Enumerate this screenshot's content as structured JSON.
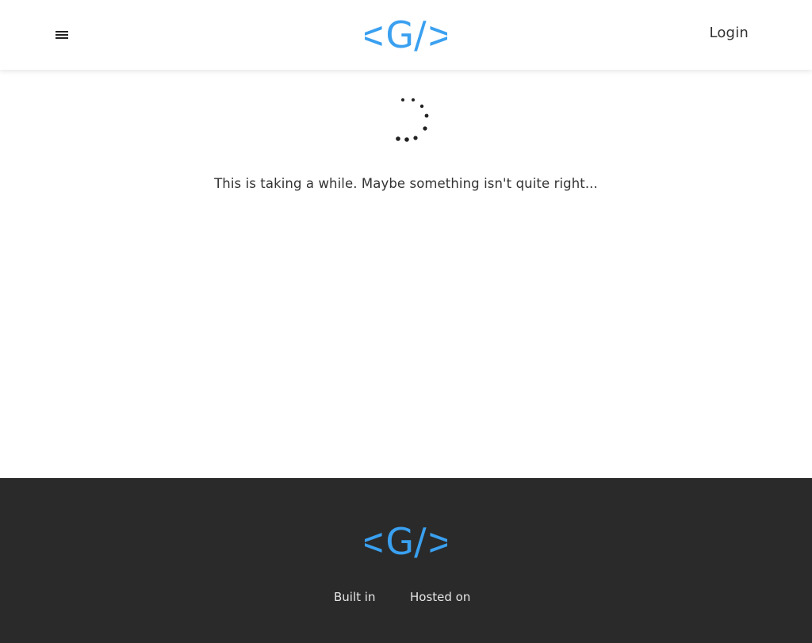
{
  "header": {
    "menu_icon": "hamburger-menu-icon",
    "logo_text": "<G/>",
    "login_label": "Login"
  },
  "main": {
    "spinner_icon": "loading-spinner-icon",
    "loading_message": "This is taking a while. Maybe something isn't quite right..."
  },
  "footer": {
    "logo_text": "<G/>",
    "built_in_label": "Built in",
    "hosted_on_label": "Hosted on"
  },
  "colors": {
    "brand_blue": "#3aa0f0",
    "footer_bg": "#2a2a2a",
    "text_dark": "#333333"
  }
}
